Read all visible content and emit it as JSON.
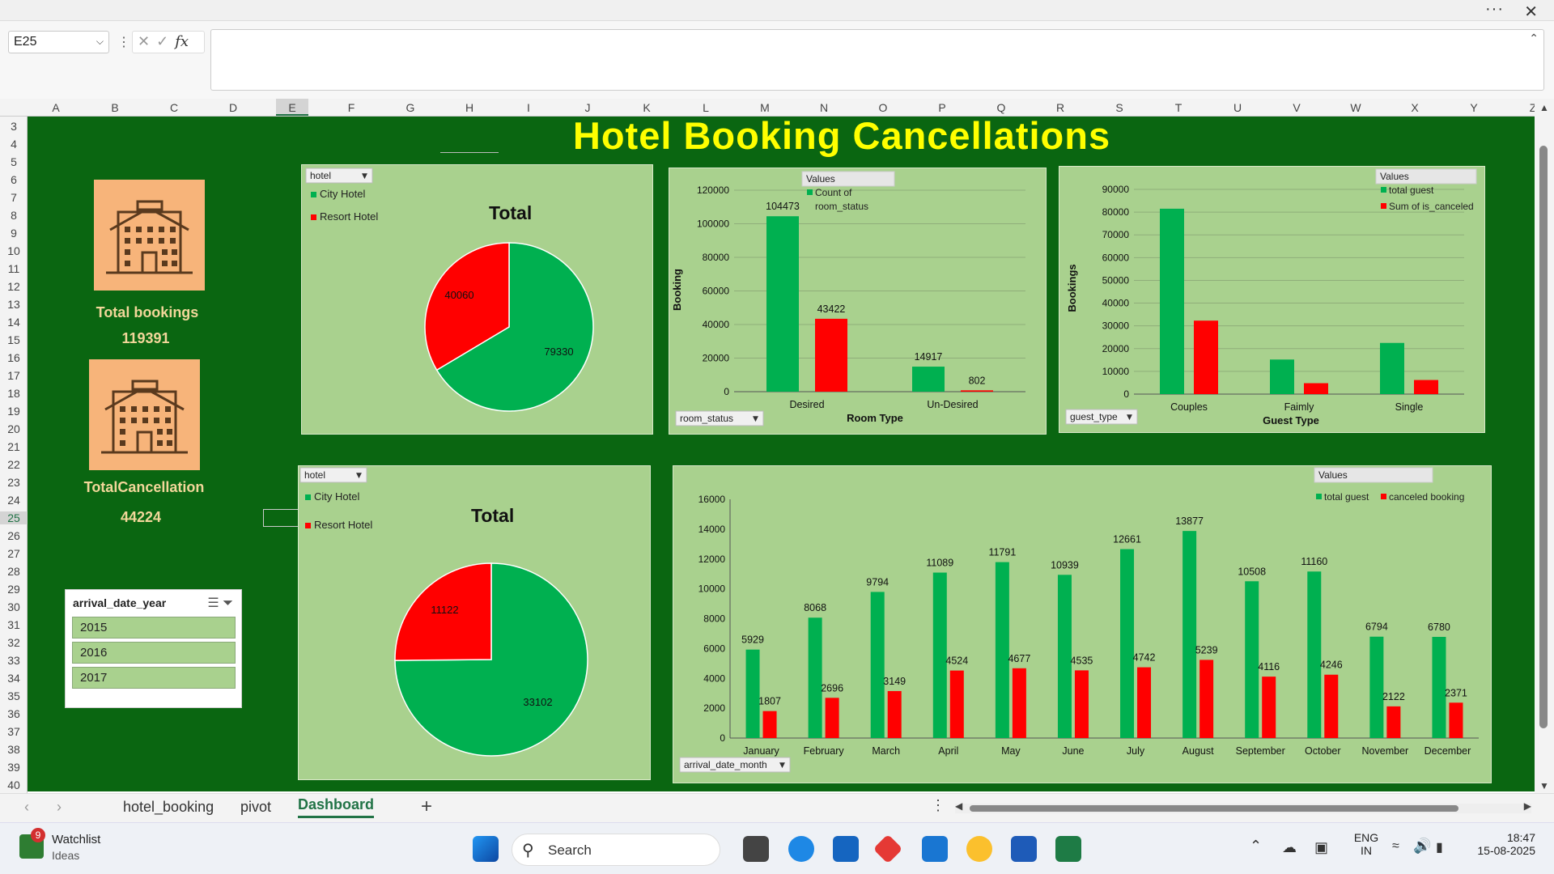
{
  "window": {
    "more": "···",
    "close": "✕"
  },
  "formula_bar": {
    "name_box": "E25",
    "formula_value": "",
    "fx": "fx"
  },
  "columns": [
    "A",
    "B",
    "C",
    "D",
    "E",
    "F",
    "G",
    "H",
    "I",
    "J",
    "K",
    "L",
    "M",
    "N",
    "O",
    "P",
    "Q",
    "R",
    "S",
    "T",
    "U",
    "V",
    "W",
    "X",
    "Y",
    "Z"
  ],
  "selected_column": "E",
  "rows": [
    "3",
    "4",
    "5",
    "6",
    "7",
    "8",
    "9",
    "10",
    "11",
    "12",
    "13",
    "14",
    "15",
    "16",
    "17",
    "18",
    "19",
    "20",
    "21",
    "22",
    "23",
    "24",
    "25",
    "26",
    "27",
    "28",
    "29",
    "30",
    "31",
    "32",
    "33",
    "34",
    "35",
    "36",
    "37",
    "38",
    "39",
    "40"
  ],
  "selected_row": "25",
  "dashboard": {
    "title": "Hotel Booking Cancellations",
    "kpi1": {
      "label": "Total bookings",
      "value": "119391",
      "icon": "hotel-building-icon"
    },
    "kpi2": {
      "label": "TotalCancellation",
      "value": "44224",
      "icon": "hotel-building-icon"
    },
    "colors": {
      "green": "#00b050",
      "red": "#ff0000",
      "panel": "#a9d18e",
      "background": "#0a6611",
      "title": "#ffff00"
    },
    "slicer": {
      "title": "arrival_date_year",
      "items": [
        "2015",
        "2016",
        "2017"
      ]
    }
  },
  "chart_data": [
    {
      "type": "pie",
      "title": "Total",
      "filter": "hotel",
      "legend": [
        "City Hotel",
        "Resort Hotel"
      ],
      "values": [
        79330,
        40060
      ],
      "colors": [
        "#00b050",
        "#ff0000"
      ]
    },
    {
      "type": "bar",
      "title": "",
      "ylabel": "Booking",
      "xlabel": "Room Type",
      "legend_title": "Values",
      "categories": [
        "Desired",
        "Un-Desired"
      ],
      "series": [
        {
          "name": "Count of room_status",
          "values": [
            104473,
            14917
          ]
        },
        {
          "name": "",
          "values": [
            43422,
            802
          ]
        }
      ],
      "ylim": [
        0,
        120000
      ],
      "ticks": [
        0,
        20000,
        40000,
        60000,
        80000,
        100000,
        120000
      ],
      "filter": "room_status",
      "grid": true
    },
    {
      "type": "bar",
      "title": "",
      "ylabel": "Bookings",
      "xlabel": "Guest Type",
      "legend_title": "Values",
      "categories": [
        "Couples",
        "Faimly",
        "Single"
      ],
      "series": [
        {
          "name": "total guest",
          "values": [
            81500,
            15200,
            22500
          ]
        },
        {
          "name": "Sum of is_canceled",
          "values": [
            32300,
            4800,
            6200
          ]
        }
      ],
      "ylim": [
        0,
        90000
      ],
      "ticks": [
        0,
        10000,
        20000,
        30000,
        40000,
        50000,
        60000,
        70000,
        80000,
        90000
      ],
      "filter": "guest_type",
      "grid": true
    },
    {
      "type": "pie",
      "title": "Total",
      "filter": "hotel",
      "legend": [
        "City Hotel",
        "Resort Hotel"
      ],
      "values": [
        33102,
        11122
      ],
      "colors": [
        "#00b050",
        "#ff0000"
      ]
    },
    {
      "type": "bar",
      "title": "",
      "legend_title": "Values",
      "categories": [
        "January",
        "February",
        "March",
        "April",
        "May",
        "June",
        "July",
        "August",
        "September",
        "October",
        "November",
        "December"
      ],
      "series": [
        {
          "name": "total guest",
          "values": [
            5929,
            8068,
            9794,
            11089,
            11791,
            10939,
            12661,
            13877,
            10508,
            11160,
            6794,
            6780
          ]
        },
        {
          "name": "canceled booking",
          "values": [
            1807,
            2696,
            3149,
            4524,
            4677,
            4535,
            4742,
            5239,
            4116,
            4246,
            2122,
            2371
          ]
        }
      ],
      "ylim": [
        0,
        16000
      ],
      "ticks": [
        0,
        2000,
        4000,
        6000,
        8000,
        10000,
        12000,
        14000,
        16000
      ],
      "filter": "arrival_date_month",
      "grid": false
    }
  ],
  "sheets": {
    "tabs": [
      "hotel_booking",
      "pivot",
      "Dashboard"
    ],
    "active": "Dashboard",
    "add": "+"
  },
  "taskbar": {
    "watchlist_title": "Watchlist",
    "watchlist_sub": "Ideas",
    "watchlist_badge": "9",
    "search_label": "Search",
    "lang1": "ENG",
    "lang2": "IN",
    "time": "18:47",
    "date": "15-08-2025"
  }
}
